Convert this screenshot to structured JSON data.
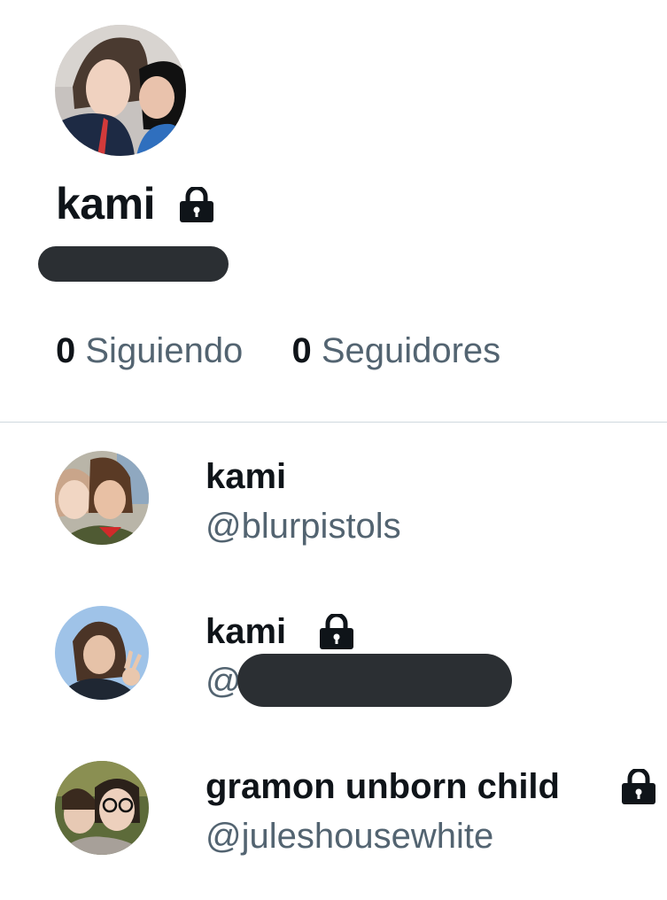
{
  "profile": {
    "display_name": "kami",
    "handle_redacted": true,
    "protected": true,
    "lock_icon": "lock-icon"
  },
  "stats": {
    "following_count": "0",
    "following_label": "Siguiendo",
    "followers_count": "0",
    "followers_label": "Seguidores"
  },
  "accounts": [
    {
      "name": "kami",
      "handle": "@blurpistols",
      "protected": false
    },
    {
      "name": "kami",
      "handle_prefix": "@",
      "handle_redacted": true,
      "protected": true
    },
    {
      "name": "gramon unborn child",
      "handle": "@juleshousewhite",
      "protected": true
    }
  ],
  "colors": {
    "primary_text": "#0f1419",
    "secondary_text": "#536471",
    "divider": "#cfd9de",
    "redaction": "#2b2f33"
  }
}
